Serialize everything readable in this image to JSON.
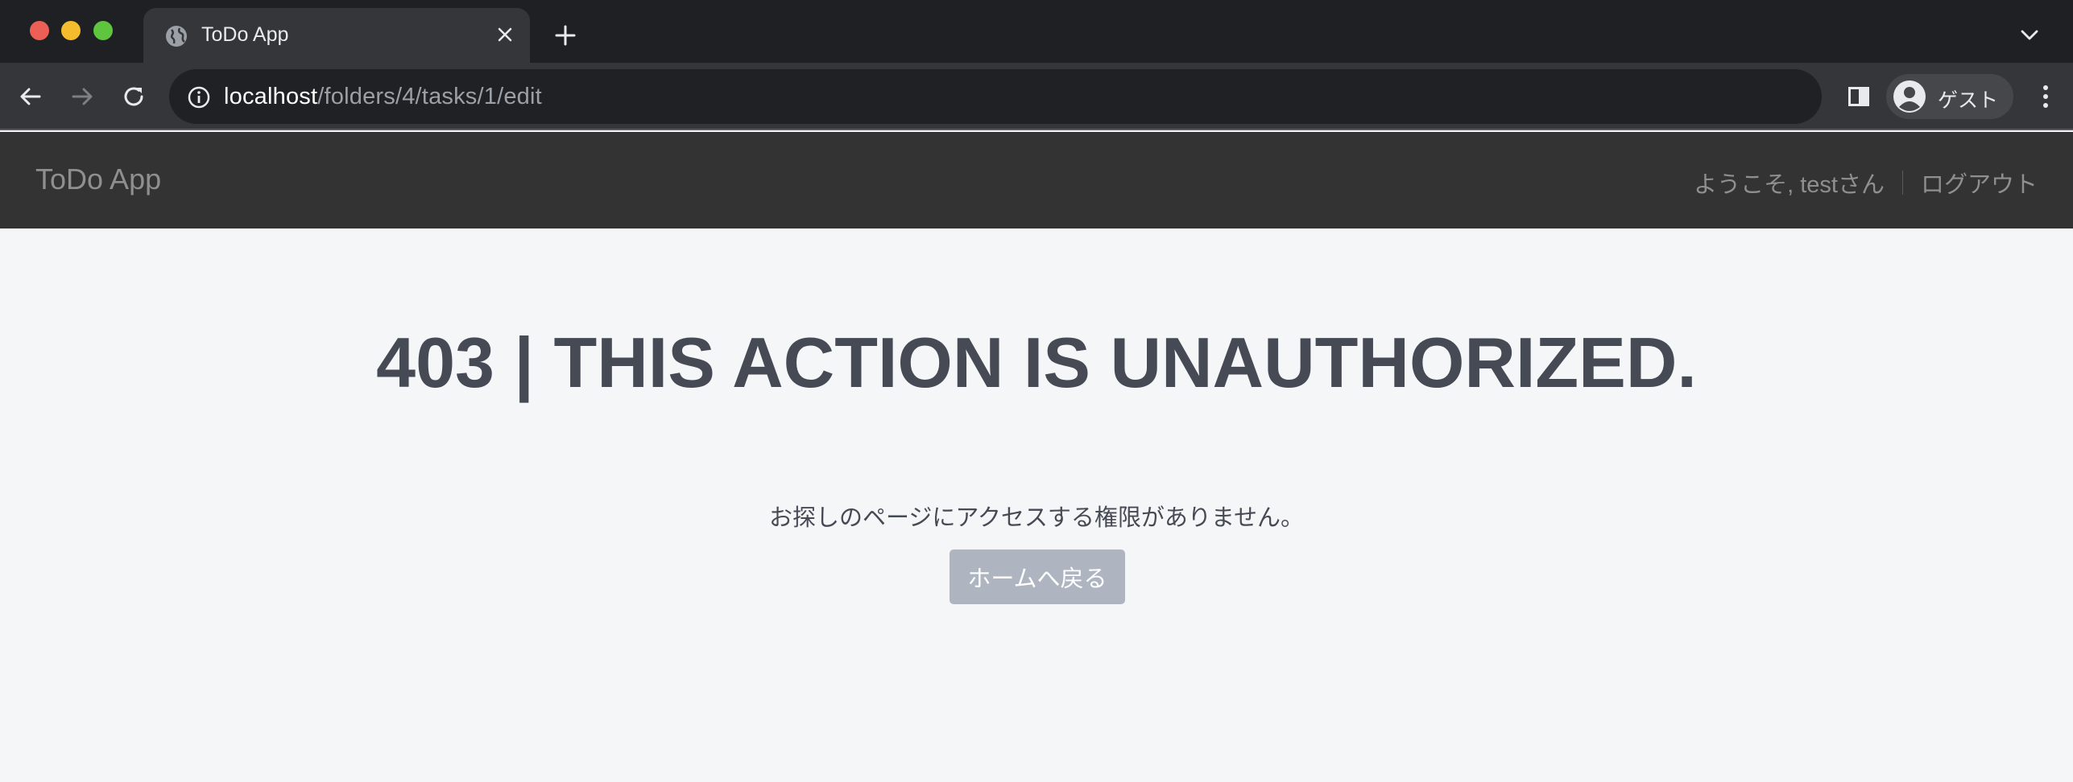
{
  "browser": {
    "tab": {
      "title": "ToDo App",
      "favicon": "globe-icon"
    },
    "url": {
      "host": "localhost",
      "path": "/folders/4/tasks/1/edit"
    },
    "profile": {
      "label": "ゲスト",
      "icon": "avatar-icon"
    },
    "colors": {
      "tabstrip": "#1f2023",
      "toolbar": "#35363a",
      "omnibox": "#202124"
    }
  },
  "app": {
    "brand": "ToDo App",
    "welcome": "ようこそ, testさん",
    "logout": "ログアウト",
    "colors": {
      "navbar": "#333333",
      "nav_text": "#8f8f8f"
    }
  },
  "error": {
    "title": "403 | This action is unauthorized.",
    "message": "お探しのページにアクセスする権限がありません。",
    "home_button": "ホームへ戻る",
    "colors": {
      "text": "#454a55",
      "button": "#aeb4c0",
      "background": "#f5f6f8"
    }
  }
}
